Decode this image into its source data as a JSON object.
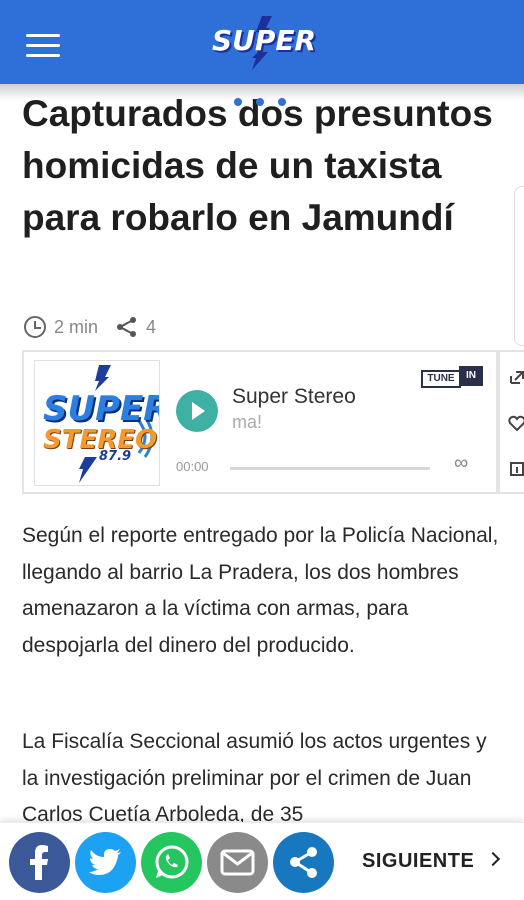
{
  "header": {
    "menu_icon": "hamburger-icon",
    "logo_text": "SUPER",
    "brand_color": "#2f6fd8"
  },
  "article": {
    "title": "Capturados dos presuntos homicidas de un taxista para robarlo en Jamundí",
    "read_time": "2 min",
    "share_count": "4",
    "paragraphs": [
      "Según el reporte entregado por la Policía Nacional, llegando al barrio La Pradera, los dos hombres amenazaron a la víctima con armas, para despojarla del dinero del producido.",
      "La Fiscalía Seccional asumió los actos urgentes y la investigación preliminar por el crimen de Juan Carlos Cuetía Arboleda, de 35"
    ]
  },
  "player": {
    "station_name": "Super Stereo",
    "station_sub": "ma!",
    "time": "00:00",
    "loop_symbol": "∞",
    "logo_line1": "SUPER",
    "logo_line2": "STEREO",
    "logo_line3": "87.9",
    "tunein_label1": "TUNE",
    "tunein_label2": "IN",
    "play_color": "#3fb0a4"
  },
  "sharebar": {
    "buttons": [
      {
        "name": "facebook",
        "color": "#3b5998",
        "icon": "facebook-icon"
      },
      {
        "name": "twitter",
        "color": "#1da1f2",
        "icon": "twitter-icon"
      },
      {
        "name": "whatsapp",
        "color": "#25c660",
        "icon": "whatsapp-icon"
      },
      {
        "name": "email",
        "color": "#8a8a8a",
        "icon": "envelope-icon"
      },
      {
        "name": "share",
        "color": "#1878bf",
        "icon": "share-icon"
      }
    ],
    "next_label": "SIGUIENTE"
  }
}
